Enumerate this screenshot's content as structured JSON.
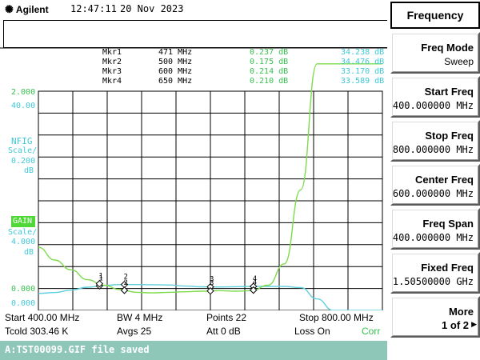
{
  "header": {
    "brand": "Agilent",
    "time": "12:47:11",
    "date": "20 Nov 2023"
  },
  "markers": [
    {
      "name": "Mkr1",
      "freq": "471 MHz",
      "nfig": "0.237 dB",
      "gain": "34.238 dB"
    },
    {
      "name": "Mkr2",
      "freq": "500 MHz",
      "nfig": "0.175 dB",
      "gain": "34.476 dB"
    },
    {
      "name": "Mkr3",
      "freq": "600 MHz",
      "nfig": "0.214 dB",
      "gain": "33.170 dB"
    },
    {
      "name": "Mkr4",
      "freq": "650 MHz",
      "nfig": "0.210 dB",
      "gain": "33.589 dB"
    }
  ],
  "scale": {
    "nfig_ref_top": "2.000",
    "gain_ref_top": "40.00",
    "nfig_label": "NFIG",
    "nfig_scale_word": "Scale/",
    "nfig_scale_value": "0.200",
    "nfig_unit": "dB",
    "gain_label": "GAIN",
    "gain_scale_word": "Scale/",
    "gain_scale_value": "4.000",
    "gain_unit": "dB",
    "gain_ref_bottom": "0.000",
    "nfig_ref_bottom": "0.000"
  },
  "annotations": {
    "start": "Start 400.00 MHz",
    "bw": "BW 4 MHz",
    "points": "Points 22",
    "stop": "Stop 800.00 MHz",
    "tcold": "Tcold 303.46 K",
    "avgs": "Avgs 25",
    "att": "Att 0 dB",
    "loss": "Loss On",
    "corr": "Corr"
  },
  "status_message": "A:TST00099.GIF file saved",
  "softkeys": {
    "title": "Frequency",
    "freq_mode": {
      "label": "Freq Mode",
      "value": "Sweep"
    },
    "start_freq": {
      "label": "Start Freq",
      "value": "400.000000 MHz"
    },
    "stop_freq": {
      "label": "Stop Freq",
      "value": "800.000000 MHz"
    },
    "center_freq": {
      "label": "Center Freq",
      "value": "600.000000 MHz"
    },
    "freq_span": {
      "label": "Freq Span",
      "value": "400.000000 MHz"
    },
    "fixed_freq": {
      "label": "Fixed Freq",
      "value": "1.50500000 GHz"
    },
    "more": {
      "label": "More",
      "value": "1 of 2"
    }
  },
  "colors": {
    "nfig_trace": "#5fd0dc",
    "gain_trace": "#7ddc4c",
    "gain_box": "#4fd838",
    "status_bar": "#8ec6b8",
    "marker_nfig_text": "#5fd0dc",
    "marker_gain_text": "#38c050"
  },
  "chart_data": {
    "type": "line",
    "x_range_mhz": [
      400,
      800
    ],
    "series": [
      {
        "name": "NFIG",
        "x": [
          400,
          419,
          438,
          457,
          476,
          495,
          514,
          533,
          552,
          571,
          590,
          610,
          629,
          648,
          667,
          686,
          705,
          724,
          743,
          762,
          781,
          800
        ],
        "values": [
          0.155,
          0.163,
          0.185,
          0.212,
          0.228,
          0.236,
          0.236,
          0.234,
          0.232,
          0.222,
          0.215,
          0.214,
          0.216,
          0.219,
          0.219,
          0.218,
          0.208,
          0.105,
          0.0,
          0.0,
          0.0,
          0.0
        ],
        "scale_per_div": 0.2,
        "top_ref": 2.0,
        "unit": "dB"
      },
      {
        "name": "GAIN",
        "x": [
          400,
          419,
          438,
          457,
          476,
          495,
          514,
          533,
          552,
          571,
          590,
          610,
          629,
          648,
          667,
          686,
          705,
          724,
          743,
          762,
          781,
          800
        ],
        "values": [
          11.5,
          9.2,
          7.4,
          5.6,
          4.6,
          3.8,
          3.3,
          3.2,
          3.3,
          3.4,
          3.5,
          3.6,
          3.5,
          3.6,
          4.6,
          8.5,
          22.0,
          45.0,
          45.0,
          45.0,
          45.0,
          45.0
        ],
        "scale_per_div": 4.0,
        "top_ref": 40.0,
        "unit": "dB"
      }
    ],
    "marker_freqs_mhz": [
      471,
      500,
      600,
      650
    ],
    "grid": true
  }
}
